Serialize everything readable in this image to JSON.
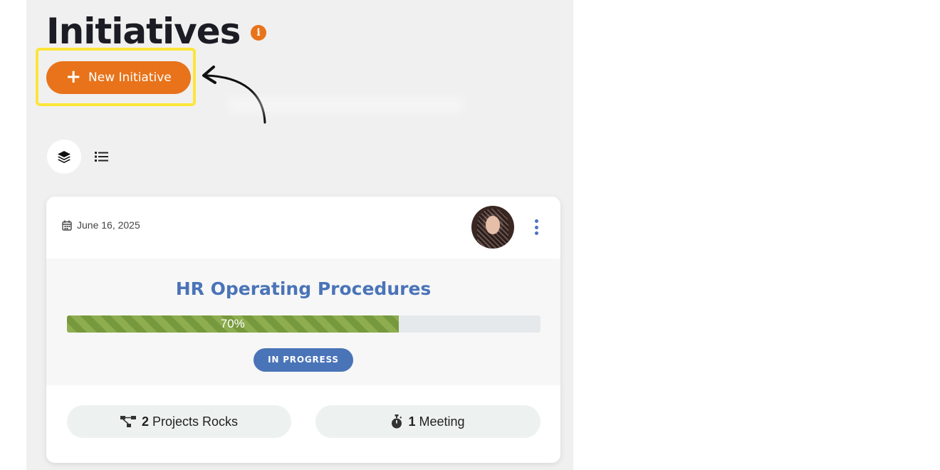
{
  "page": {
    "title": "Initiatives",
    "info_icon": "info-circle-icon",
    "accent_color": "#e8731a",
    "highlight_color": "#fde53a"
  },
  "toolbar": {
    "new_button_label": "New Initiative",
    "new_button_icon": "plus-icon"
  },
  "view_toggles": [
    {
      "icon": "layers-icon",
      "active": true
    },
    {
      "icon": "list-icon",
      "active": false
    }
  ],
  "initiative": {
    "date": "June 16, 2025",
    "title": "HR Operating Procedures",
    "progress_percent": 70,
    "progress_label": "70%",
    "status": "IN PROGRESS",
    "status_color": "#4a74b8",
    "projects_count": "2",
    "projects_label": "Projects Rocks",
    "meetings_count": "1",
    "meetings_label": "Meeting"
  }
}
